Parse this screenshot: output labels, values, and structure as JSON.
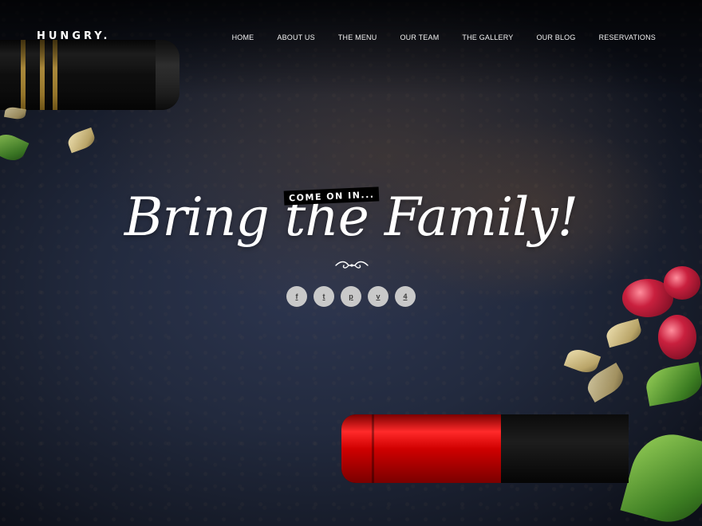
{
  "site": {
    "logo": "HUNGRY."
  },
  "nav": {
    "items": [
      {
        "label": "HOME"
      },
      {
        "label": "ABOUT US"
      },
      {
        "label": "THE MENU"
      },
      {
        "label": "OUR TEAM"
      },
      {
        "label": "THE GALLERY"
      },
      {
        "label": "OUR BLOG"
      },
      {
        "label": "RESERVATIONS"
      }
    ]
  },
  "hero": {
    "badge": "COME ON IN...",
    "headline": "Bring the Family!"
  },
  "social": {
    "items": [
      {
        "icon": "facebook-icon",
        "glyph": "f"
      },
      {
        "icon": "twitter-icon",
        "glyph": "t"
      },
      {
        "icon": "pinterest-icon",
        "glyph": "p"
      },
      {
        "icon": "vine-icon",
        "glyph": "v"
      },
      {
        "icon": "foursquare-icon",
        "glyph": "4"
      }
    ]
  },
  "colors": {
    "badge_bg": "#000000",
    "social_bg": "#c9c9c9",
    "text": "#ffffff"
  }
}
